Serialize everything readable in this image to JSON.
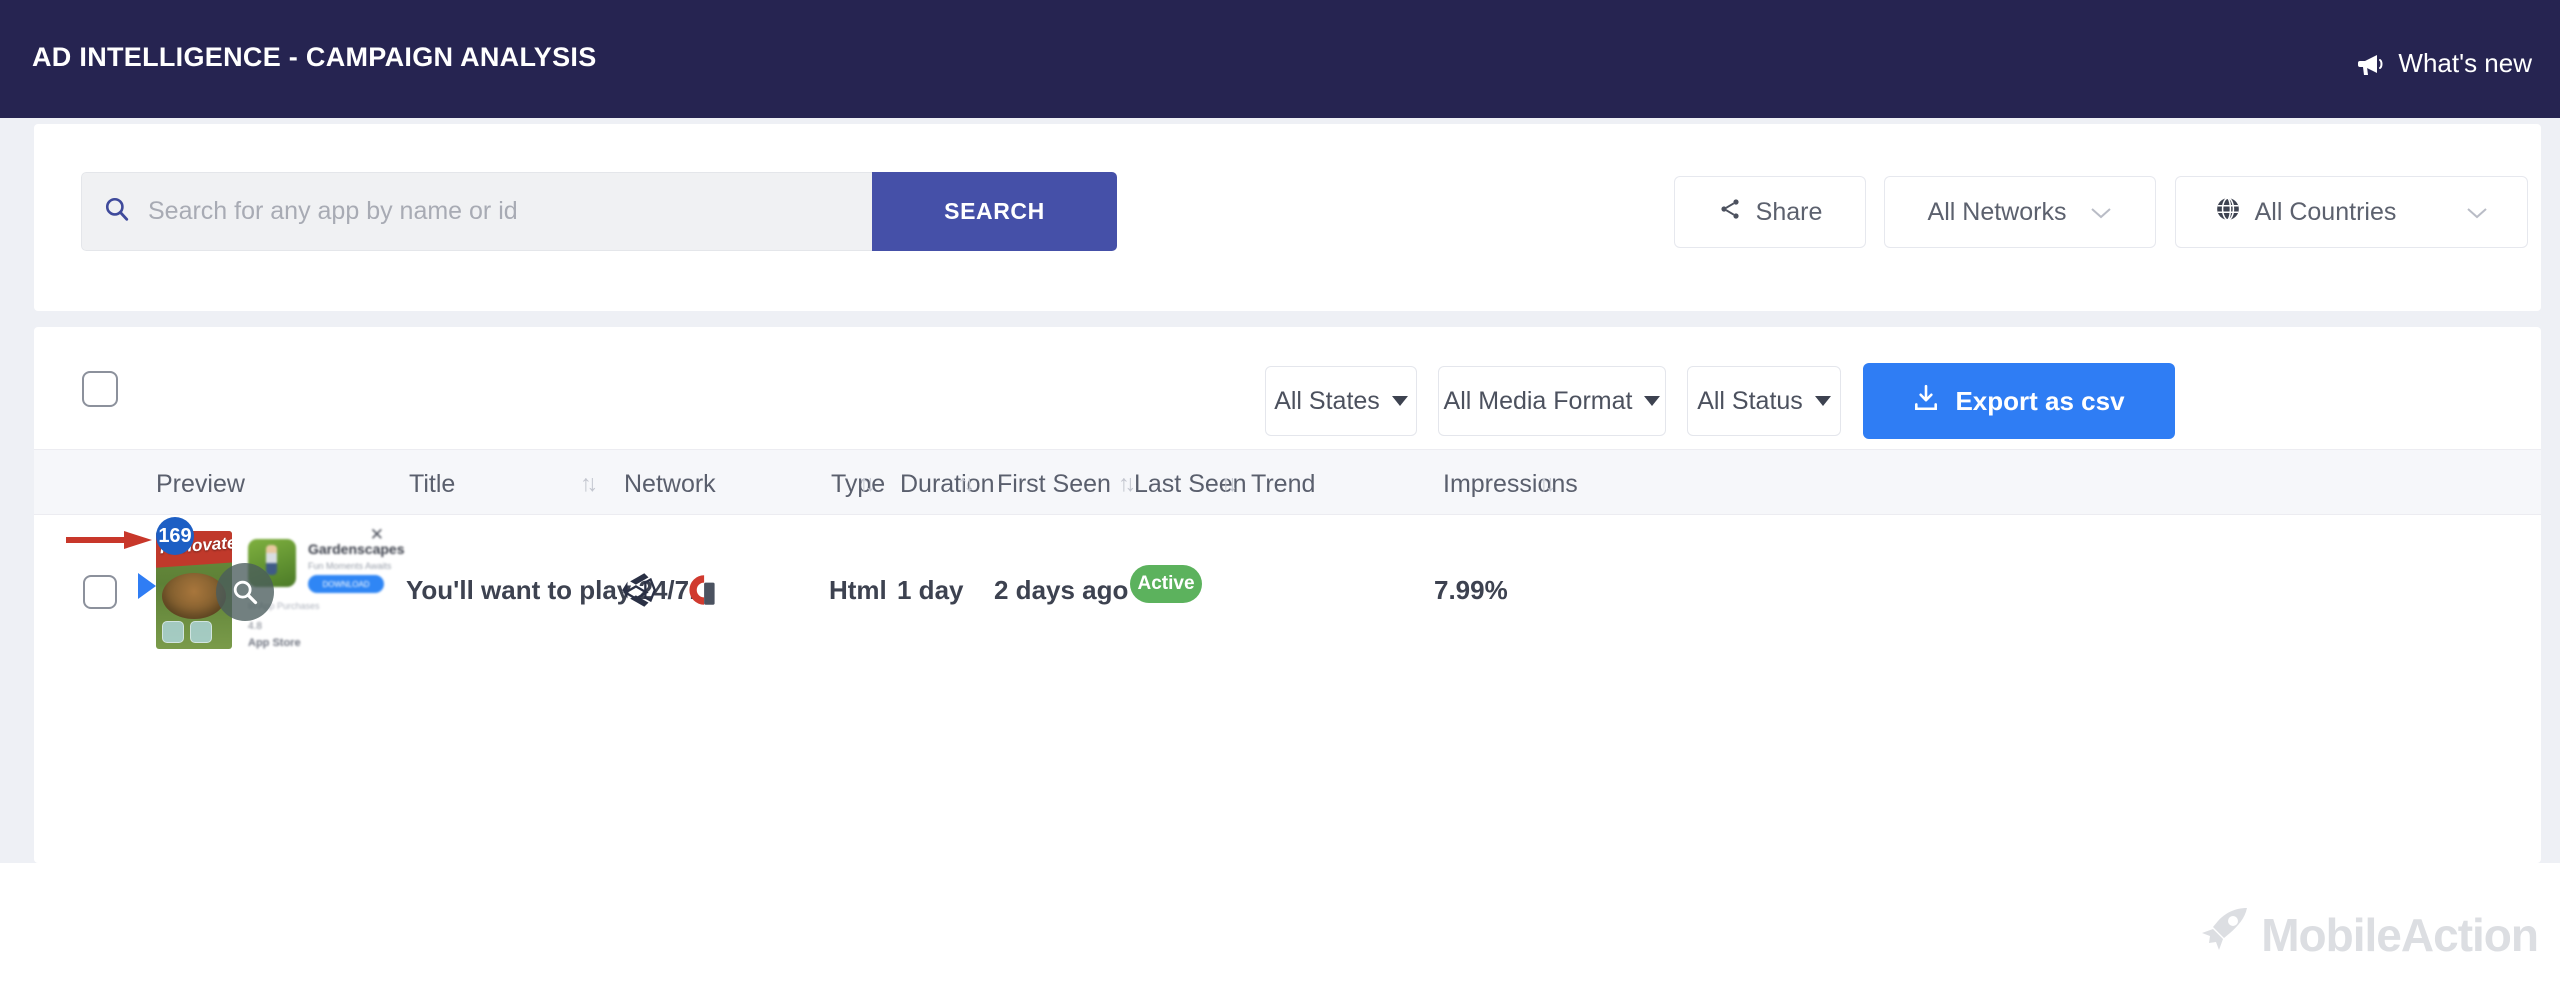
{
  "topbar": {
    "title": "AD INTELLIGENCE - CAMPAIGN ANALYSIS",
    "whats_new": "What's new",
    "megaphone_icon": "megaphone-icon",
    "bg_color": "#262451"
  },
  "search": {
    "placeholder": "Search for any app by name or id",
    "value": "",
    "button_label": "SEARCH",
    "button_color": "#4550a8",
    "search_icon": "search-icon",
    "share_label": "Share",
    "share_icon": "share-icon",
    "networks_label": "All Networks",
    "countries_label": "All Countries",
    "globe_icon": "globe-icon",
    "chevron_icon": "chevron-down-icon"
  },
  "toolbar": {
    "all_states": "All States",
    "all_media_format": "All Media Format",
    "all_status": "All Status",
    "export_label": "Export as csv",
    "export_icon": "download-icon",
    "export_color": "#2f7df4"
  },
  "table": {
    "columns": [
      {
        "label": "Preview",
        "sortable": false
      },
      {
        "label": "Title",
        "sortable": true
      },
      {
        "label": "Network",
        "sortable": false
      },
      {
        "label": "Type",
        "sortable": true
      },
      {
        "label": "Duration",
        "sortable": true
      },
      {
        "label": "First Seen",
        "sortable": true
      },
      {
        "label": "Last Seen",
        "sortable": true
      },
      {
        "label": "Trend",
        "sortable": false
      },
      {
        "label": "Impressions",
        "sortable": true
      }
    ],
    "sort_glyph": "↑↓",
    "rows": [
      {
        "badge": "169",
        "creative_text": "Renovate!",
        "app_name": "Gardenscapes",
        "app_subtitle": "Fun Moments Awaits",
        "app_download": "DOWNLOAD",
        "app_meta": "In-App Purchases",
        "app_rating": "4.8",
        "app_store": "App Store",
        "title": "You'll want to play 24/7.",
        "networks": [
          "unity-icon",
          "applovin-icon"
        ],
        "type": "Html",
        "duration": "1 day",
        "first_seen": "2 days ago",
        "status": "Active",
        "status_color": "#5cb25d",
        "trend": "",
        "impressions": "7.99%"
      }
    ]
  },
  "watermark": {
    "text": "MobileAction",
    "icon": "rocket-icon"
  }
}
